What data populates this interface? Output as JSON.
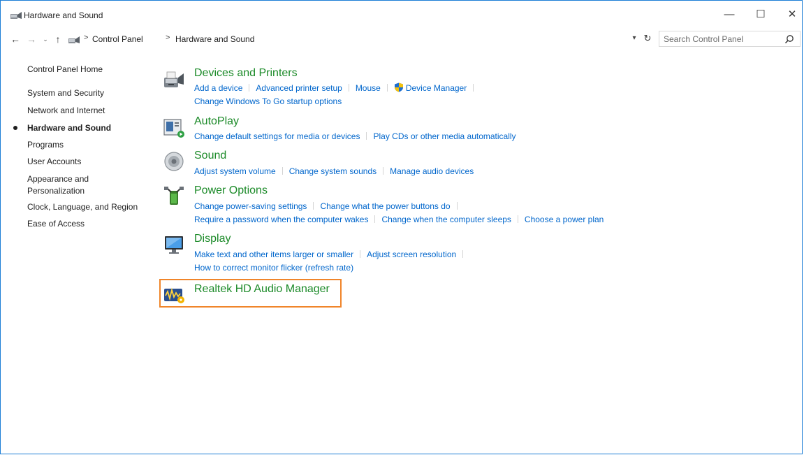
{
  "window": {
    "title": "Hardware and Sound",
    "controls": {
      "minimize": "—",
      "maximize": "☐",
      "close": "✕"
    }
  },
  "address": {
    "breadcrumb": [
      "Control Panel",
      "Hardware and Sound"
    ],
    "separator": ">",
    "search_placeholder": "Search Control Panel"
  },
  "sidebar": {
    "items": [
      {
        "label": "Control Panel Home"
      },
      {
        "label": "System and Security"
      },
      {
        "label": "Network and Internet"
      },
      {
        "label": "Hardware and Sound",
        "active": true
      },
      {
        "label": "Programs"
      },
      {
        "label": "User Accounts"
      },
      {
        "label": "Appearance and"
      },
      {
        "label": "Personalization"
      },
      {
        "label": "Clock, Language, and Region"
      },
      {
        "label": "Ease of Access"
      }
    ]
  },
  "categories": {
    "devices": {
      "title": "Devices and Printers",
      "links": [
        "Add a device",
        "Advanced printer setup",
        "Mouse",
        "Device Manager",
        "Change Windows To Go startup options"
      ]
    },
    "autoplay": {
      "title": "AutoPlay",
      "links": [
        "Change default settings for media or devices",
        "Play CDs or other media automatically"
      ]
    },
    "sound": {
      "title": "Sound",
      "links": [
        "Adjust system volume",
        "Change system sounds",
        "Manage audio devices"
      ]
    },
    "power": {
      "title": "Power Options",
      "links": [
        "Change power-saving settings",
        "Change what the power buttons do",
        "Require a password when the computer wakes",
        "Change when the computer sleeps",
        "Choose a power plan"
      ]
    },
    "display": {
      "title": "Display",
      "links": [
        "Make text and other items larger or smaller",
        "Adjust screen resolution",
        "How to correct monitor flicker (refresh rate)"
      ]
    },
    "realtek": {
      "title": "Realtek HD Audio Manager"
    }
  },
  "colors": {
    "category_title": "#1b8a28",
    "link": "#0066cc",
    "highlight": "#f0852a",
    "window_border": "#1c7ed6"
  }
}
